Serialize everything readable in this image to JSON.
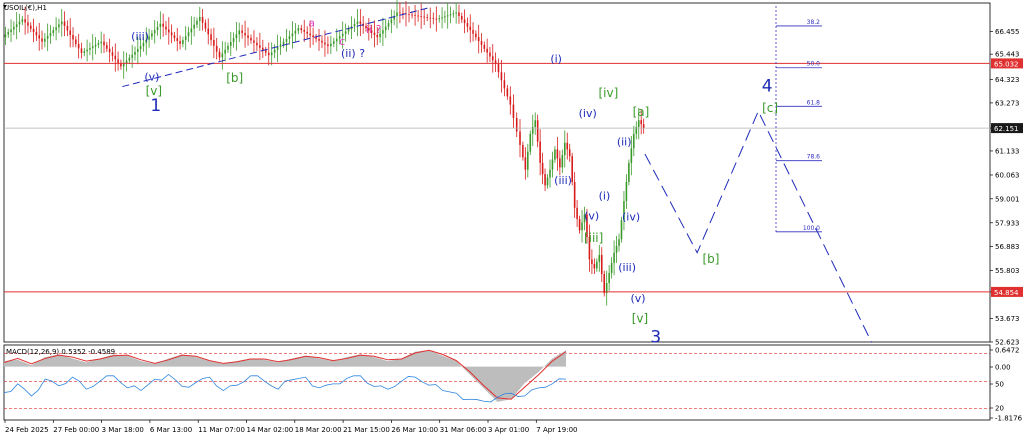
{
  "symbol_header": "USOIL(€),H1",
  "macd_header": "MACD(12,26,9) 0.5352 -0.4589",
  "colors": {
    "up_candle": "#3a9a2a",
    "down_candle": "#d81a1a",
    "hline": "#e03030",
    "wave_blue": "#1f2bb8",
    "wave_green": "#3a9a2a",
    "wave_magenta": "#e040c0",
    "projection": "#1f2bb8",
    "macd_hist": "#bdbdbd",
    "macd_line": "#2e86de",
    "signal_line": "#e03030",
    "price_tag_red": "#e03030",
    "price_tag_dark": "#1a1a1a",
    "fib_line": "#3030c0"
  },
  "chart_data": {
    "type": "line",
    "instrument": "USOIL(€),H1",
    "ylim": [
      52.623,
      67.5
    ],
    "y_ticks": [
      "66.455",
      "65.443",
      "64.323",
      "63.273",
      "62.151",
      "61.133",
      "60.063",
      "59.001",
      "57.933",
      "56.883",
      "55.803",
      "54.854",
      "53.673",
      "52.623"
    ],
    "x_labels": [
      "24 Feb 2025",
      "27 Feb 00:00",
      "3 Mar 18:00",
      "6 Mar 13:00",
      "11 Mar 07:00",
      "14 Mar 02:00",
      "18 Mar 20:00",
      "21 Mar 15:00",
      "26 Mar 10:00",
      "31 Mar 06:00",
      "3 Apr 01:00",
      "7 Apr 19:00"
    ],
    "current_price": "62.151",
    "price_tags": [
      "65.032",
      "62.151",
      "54.854"
    ],
    "horizontal_lines": [
      65.032,
      54.854
    ],
    "price_path": [
      [
        0.0,
        66.2
      ],
      [
        0.02,
        67.0
      ],
      [
        0.04,
        66.0
      ],
      [
        0.06,
        66.9
      ],
      [
        0.08,
        65.5
      ],
      [
        0.1,
        66.0
      ],
      [
        0.12,
        64.9
      ],
      [
        0.14,
        65.8
      ],
      [
        0.16,
        66.8
      ],
      [
        0.18,
        65.9
      ],
      [
        0.2,
        67.1
      ],
      [
        0.22,
        65.3
      ],
      [
        0.24,
        66.5
      ],
      [
        0.27,
        65.4
      ],
      [
        0.3,
        66.6
      ],
      [
        0.33,
        65.8
      ],
      [
        0.36,
        66.9
      ],
      [
        0.38,
        66.2
      ],
      [
        0.4,
        67.3
      ],
      [
        0.44,
        67.0
      ],
      [
        0.46,
        67.3
      ],
      [
        0.48,
        66.2
      ],
      [
        0.5,
        65.0
      ],
      [
        0.515,
        63.2
      ],
      [
        0.525,
        61.4
      ],
      [
        0.53,
        60.3
      ],
      [
        0.535,
        61.9
      ],
      [
        0.54,
        62.5
      ],
      [
        0.545,
        60.6
      ],
      [
        0.55,
        59.6
      ],
      [
        0.555,
        60.3
      ],
      [
        0.56,
        61.2
      ],
      [
        0.565,
        60.4
      ],
      [
        0.57,
        61.5
      ],
      [
        0.575,
        60.9
      ],
      [
        0.58,
        58.6
      ],
      [
        0.585,
        57.6
      ],
      [
        0.59,
        58.3
      ],
      [
        0.595,
        56.3
      ],
      [
        0.6,
        55.9
      ],
      [
        0.605,
        56.5
      ],
      [
        0.61,
        54.8
      ],
      [
        0.615,
        55.7
      ],
      [
        0.62,
        56.6
      ],
      [
        0.625,
        57.2
      ],
      [
        0.63,
        58.9
      ],
      [
        0.635,
        60.6
      ],
      [
        0.64,
        61.9
      ],
      [
        0.645,
        62.5
      ],
      [
        0.65,
        62.15
      ]
    ],
    "fibonacci": [
      {
        "label": "38.2",
        "value": 66.7
      },
      {
        "label": "50.0",
        "value": 64.84
      },
      {
        "label": "61.8",
        "value": 63.12
      },
      {
        "label": "78.6",
        "value": 60.7
      },
      {
        "label": "100.0",
        "value": 57.53
      }
    ],
    "projection_path": [
      [
        0.65,
        61.0
      ],
      [
        0.703,
        56.6
      ],
      [
        0.765,
        62.9
      ],
      [
        0.88,
        52.6
      ]
    ],
    "support_line": [
      [
        0.12,
        64.0
      ],
      [
        0.43,
        67.5
      ]
    ],
    "wave_labels": [
      {
        "text": "(iii)",
        "x": 0.138,
        "y": 66.07,
        "color": "blue",
        "size": 11
      },
      {
        "text": "(v)",
        "x": 0.15,
        "y": 64.28,
        "color": "blue",
        "size": 11
      },
      {
        "text": "[v]",
        "x": 0.152,
        "y": 63.62,
        "color": "green",
        "size": 12
      },
      {
        "text": "1",
        "x": 0.154,
        "y": 62.92,
        "color": "blue",
        "size": 17
      },
      {
        "text": "[b]",
        "x": 0.234,
        "y": 64.21,
        "color": "green",
        "size": 12
      },
      {
        "text": "a",
        "x": 0.312,
        "y": 66.68,
        "color": "magenta",
        "size": 11
      },
      {
        "text": "c",
        "x": 0.343,
        "y": 65.85,
        "color": "magenta",
        "size": 11
      },
      {
        "text": "ii ?",
        "x": 0.375,
        "y": 66.38,
        "color": "magenta",
        "size": 11
      },
      {
        "text": "(ii) ?",
        "x": 0.354,
        "y": 65.31,
        "color": "blue",
        "size": 11
      },
      {
        "text": "(i)",
        "x": 0.56,
        "y": 65.07,
        "color": "blue",
        "size": 11
      },
      {
        "text": "[iv]",
        "x": 0.613,
        "y": 63.54,
        "color": "green",
        "size": 12
      },
      {
        "text": "(iv)",
        "x": 0.592,
        "y": 62.64,
        "color": "blue",
        "size": 11
      },
      {
        "text": "[a]",
        "x": 0.646,
        "y": 62.7,
        "color": "green",
        "size": 12
      },
      {
        "text": "(ii)",
        "x": 0.629,
        "y": 61.38,
        "color": "blue",
        "size": 11
      },
      {
        "text": "(iii)",
        "x": 0.567,
        "y": 59.67,
        "color": "blue",
        "size": 11
      },
      {
        "text": "(i)",
        "x": 0.609,
        "y": 58.98,
        "color": "blue",
        "size": 11
      },
      {
        "text": "(v)",
        "x": 0.596,
        "y": 58.09,
        "color": "blue",
        "size": 11
      },
      {
        "text": "[iii]",
        "x": 0.598,
        "y": 57.08,
        "color": "green",
        "size": 12
      },
      {
        "text": "(iv)",
        "x": 0.636,
        "y": 58.04,
        "color": "blue",
        "size": 11
      },
      {
        "text": "(iii)",
        "x": 0.632,
        "y": 55.79,
        "color": "blue",
        "size": 11
      },
      {
        "text": "(v)",
        "x": 0.643,
        "y": 54.4,
        "color": "blue",
        "size": 11
      },
      {
        "text": "[v]",
        "x": 0.645,
        "y": 53.5,
        "color": "green",
        "size": 12
      },
      {
        "text": "3",
        "x": 0.661,
        "y": 52.6,
        "color": "blue",
        "size": 17
      },
      {
        "text": "[b]",
        "x": 0.717,
        "y": 56.15,
        "color": "green",
        "size": 12
      },
      {
        "text": "4",
        "x": 0.774,
        "y": 63.77,
        "color": "blue",
        "size": 17
      },
      {
        "text": "[c]",
        "x": 0.777,
        "y": 62.87,
        "color": "green",
        "size": 12
      }
    ],
    "macd": {
      "header": "MACD(12,26,9) 0.5352 -0.4589",
      "y_ticks": [
        "0.6472",
        "0.00",
        "50",
        "20",
        "-1.8176"
      ],
      "histogram": [
        0.2,
        0.25,
        0.05,
        0.35,
        0.45,
        0.3,
        0.15,
        0.3,
        0.45,
        0.4,
        0.2,
        0.1,
        0.3,
        0.45,
        0.35,
        0.2,
        0.1,
        0.2,
        0.3,
        0.25,
        0.15,
        0.3,
        0.4,
        0.3,
        0.2,
        0.35,
        0.45,
        0.35,
        0.2,
        0.3,
        0.55,
        0.6,
        0.4,
        0.2,
        -0.3,
        -0.8,
        -1.3,
        -1.2,
        -0.6,
        -0.2,
        0.3,
        0.6
      ],
      "signal": [
        0.15,
        0.3,
        0.1,
        0.3,
        0.42,
        0.35,
        0.2,
        0.28,
        0.4,
        0.42,
        0.25,
        0.12,
        0.25,
        0.42,
        0.38,
        0.22,
        0.12,
        0.18,
        0.28,
        0.28,
        0.18,
        0.26,
        0.38,
        0.33,
        0.22,
        0.3,
        0.42,
        0.38,
        0.25,
        0.28,
        0.5,
        0.6,
        0.45,
        0.22,
        -0.2,
        -0.7,
        -1.15,
        -1.2,
        -0.75,
        -0.3,
        0.2,
        0.55
      ],
      "rsi_like": [
        35,
        48,
        30,
        55,
        45,
        58,
        40,
        52,
        60,
        42,
        38,
        55,
        62,
        44,
        50,
        58,
        38,
        46,
        60,
        52,
        40,
        54,
        58,
        42,
        48,
        56,
        60,
        44,
        40,
        52,
        58,
        46,
        38,
        34,
        25,
        22,
        28,
        34,
        30,
        42,
        48,
        55
      ]
    }
  }
}
